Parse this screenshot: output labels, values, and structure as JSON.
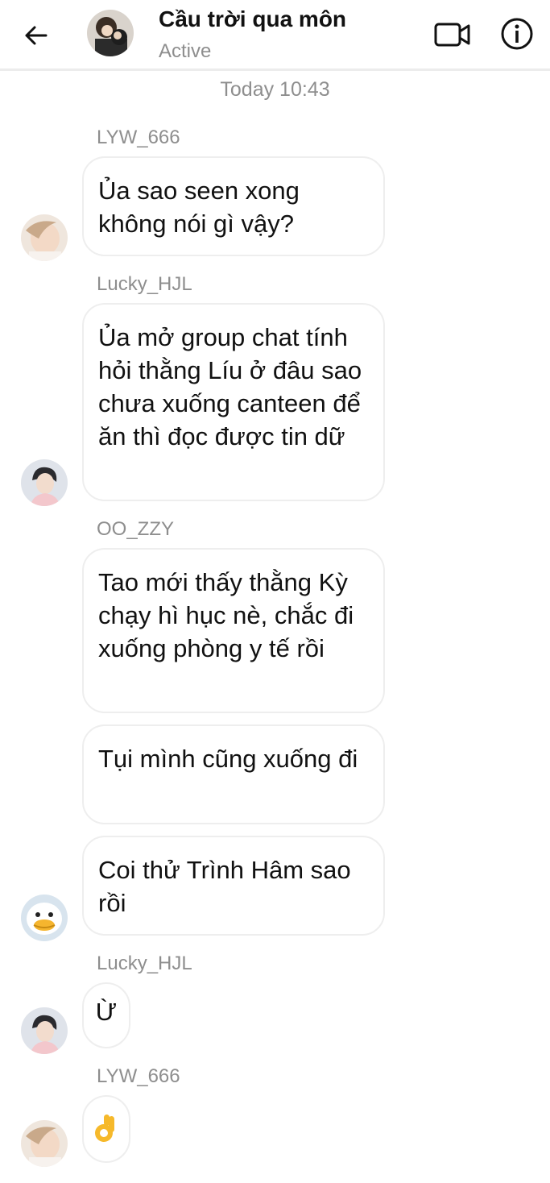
{
  "header": {
    "title": "Cầu trời qua môn",
    "status": "Active"
  },
  "timestamp": "Today 10:43",
  "messages": [
    {
      "sender": "LYW_666",
      "text": "Ủa sao seen xong không nói gì vậy?"
    },
    {
      "sender": "Lucky_HJL",
      "text": "Ủa mở group chat tính hỏi thằng Líu ở đâu sao chưa xuống canteen để ăn thì đọc được tin dữ"
    },
    {
      "sender": "OO_ZZY",
      "texts": [
        "Tao mới thấy thằng Kỳ chạy hì hục nè, chắc đi xuống phòng y tế rồi",
        "Tụi mình cũng xuống đi",
        "Coi thử Trình Hâm sao rồi"
      ]
    },
    {
      "sender": "Lucky_HJL",
      "text": "Ừ"
    },
    {
      "sender": "LYW_666",
      "text": "👌"
    }
  ],
  "icons": {
    "back": "arrow-left-icon",
    "video": "video-call-icon",
    "info": "info-icon",
    "ok_hand": "ok-hand-emoji"
  },
  "colors": {
    "text": "#111111",
    "secondary_text": "#8e8e8e",
    "bubble_border": "#eeeeee"
  }
}
